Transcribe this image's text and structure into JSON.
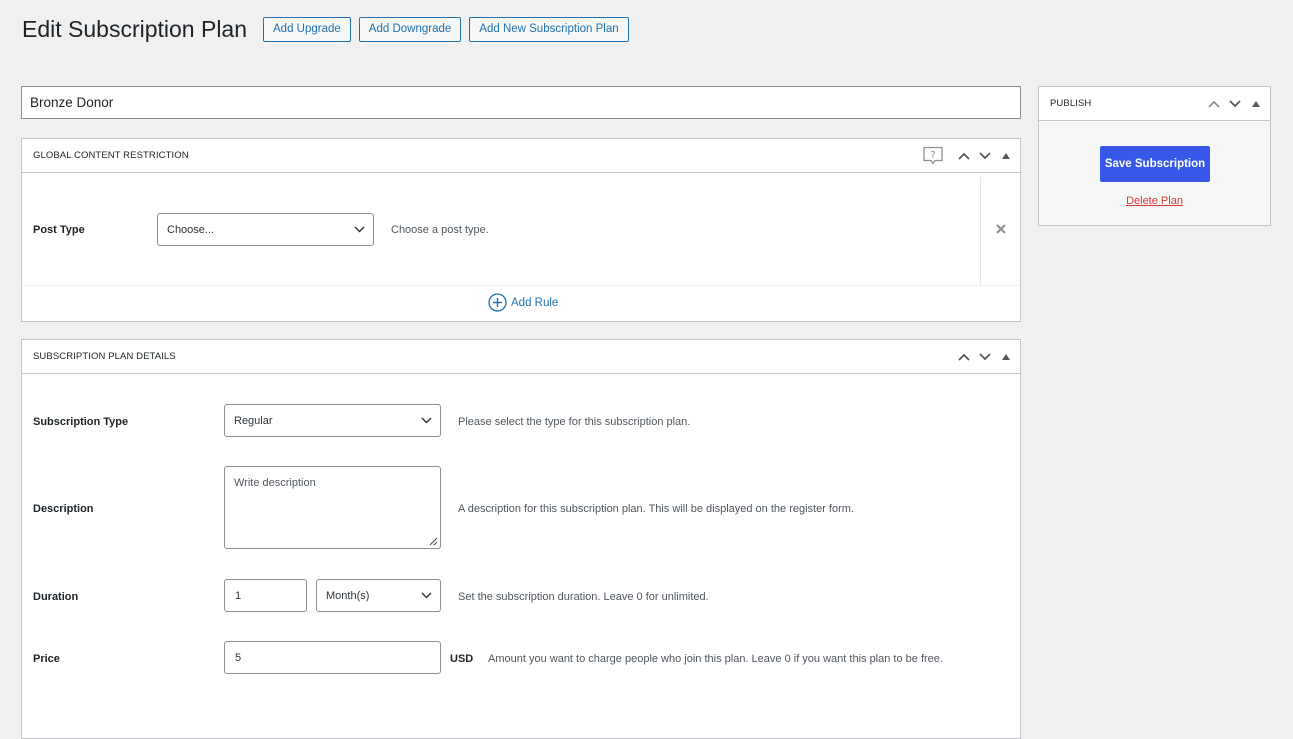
{
  "header": {
    "title": "Edit Subscription Plan",
    "buttons": [
      "Add Upgrade",
      "Add Downgrade",
      "Add New Subscription Plan"
    ]
  },
  "plan_title": "Bronze Donor",
  "global_content_restriction": {
    "title": "GLOBAL CONTENT RESTRICTION",
    "post_type": {
      "label": "Post Type",
      "selected": "Choose...",
      "help": "Choose a post type."
    },
    "add_rule_label": "Add Rule"
  },
  "subscription_plan_details": {
    "title": "SUBSCRIPTION PLAN DETAILS",
    "subscription_type": {
      "label": "Subscription Type",
      "selected": "Regular",
      "help": "Please select the type for this subscription plan."
    },
    "description": {
      "label": "Description",
      "placeholder": "Write description",
      "help": "A description for this subscription plan. This will be displayed on the register form."
    },
    "duration": {
      "label": "Duration",
      "value": "1",
      "unit": "Month(s)",
      "help": "Set the subscription duration. Leave 0 for unlimited."
    },
    "price": {
      "label": "Price",
      "value": "5",
      "currency": "USD",
      "help": "Amount you want to charge people who join this plan. Leave 0 if you want this plan to be free."
    }
  },
  "publish": {
    "title": "PUBLISH",
    "save_label": "Save Subscription",
    "delete_label": "Delete Plan"
  },
  "colors": {
    "primary_button": "#3858e9",
    "link": "#2271b1",
    "delete": "#d63638",
    "page_background": "#f0f0f1"
  }
}
